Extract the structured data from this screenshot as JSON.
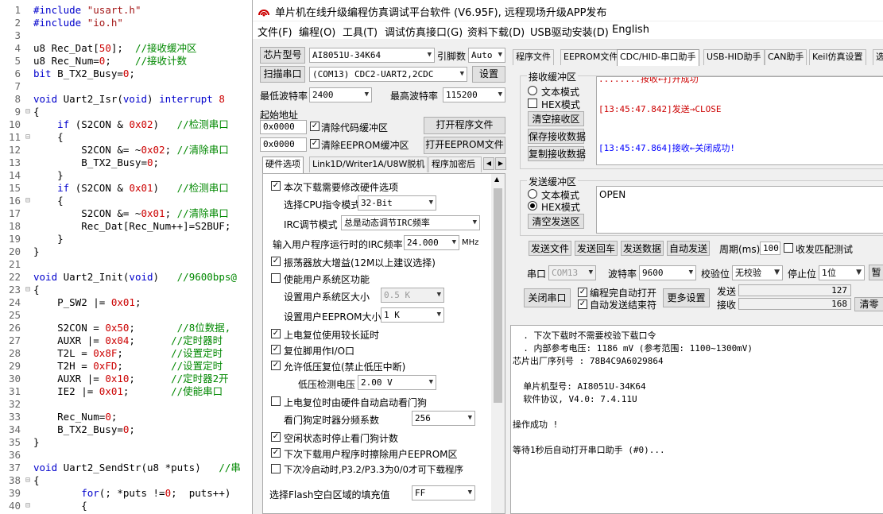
{
  "editor": {
    "lines": [
      {
        "n": "1",
        "fold": "",
        "html": "<span class='pp'>#include</span> <span class='str'>\"usart.h\"</span>"
      },
      {
        "n": "2",
        "fold": "",
        "html": "<span class='pp'>#include</span> <span class='str'>\"io.h\"</span>"
      },
      {
        "n": "3",
        "fold": "",
        "html": ""
      },
      {
        "n": "4",
        "fold": "",
        "html": "u8 Rec_Dat[<span class='num'>50</span>];  <span class='cm'>//接收缓冲区</span>"
      },
      {
        "n": "5",
        "fold": "",
        "html": "u8 Rec_Num=<span class='num'>0</span>;    <span class='cm'>//接收计数</span>"
      },
      {
        "n": "6",
        "fold": "",
        "html": "<span class='kw'>bit</span> B_TX2_Busy=<span class='num'>0</span>;"
      },
      {
        "n": "7",
        "fold": "",
        "html": ""
      },
      {
        "n": "8",
        "fold": "",
        "html": "<span class='kw'>void</span> Uart2_Isr(<span class='kw'>void</span>) <span class='kw'>interrupt</span> <span class='num'>8</span>"
      },
      {
        "n": "9",
        "fold": "⊟",
        "html": "{"
      },
      {
        "n": "10",
        "fold": "",
        "html": "    <span class='kw'>if</span> (S2CON &amp; <span class='num'>0x02</span>)   <span class='cm'>//检测串口</span>"
      },
      {
        "n": "11",
        "fold": "⊟",
        "html": "    {"
      },
      {
        "n": "12",
        "fold": "",
        "html": "        S2CON &amp;= ~<span class='num'>0x02</span>; <span class='cm'>//清除串口</span>"
      },
      {
        "n": "13",
        "fold": "",
        "html": "        B_TX2_Busy=<span class='num'>0</span>;"
      },
      {
        "n": "14",
        "fold": "",
        "html": "    }"
      },
      {
        "n": "15",
        "fold": "",
        "html": "    <span class='kw'>if</span> (S2CON &amp; <span class='num'>0x01</span>)   <span class='cm'>//检测串口</span>"
      },
      {
        "n": "16",
        "fold": "⊟",
        "html": "    {"
      },
      {
        "n": "17",
        "fold": "",
        "html": "        S2CON &amp;= ~<span class='num'>0x01</span>; <span class='cm'>//清除串口</span>"
      },
      {
        "n": "18",
        "fold": "",
        "html": "        Rec_Dat[Rec_Num++]=S2BUF;"
      },
      {
        "n": "19",
        "fold": "",
        "html": "    }"
      },
      {
        "n": "20",
        "fold": "",
        "html": "}"
      },
      {
        "n": "21",
        "fold": "",
        "html": ""
      },
      {
        "n": "22",
        "fold": "",
        "html": "<span class='kw'>void</span> Uart2_Init(<span class='kw'>void</span>)   <span class='cm'>//9600bps@</span>"
      },
      {
        "n": "23",
        "fold": "⊟",
        "html": "{"
      },
      {
        "n": "24",
        "fold": "",
        "html": "    P_SW2 |= <span class='num'>0x01</span>;"
      },
      {
        "n": "25",
        "fold": "",
        "html": ""
      },
      {
        "n": "26",
        "fold": "",
        "html": "    S2CON = <span class='num'>0x50</span>;       <span class='cm'>//8位数据,</span>"
      },
      {
        "n": "27",
        "fold": "",
        "html": "    AUXR |= <span class='num'>0x04</span>;      <span class='cm'>//定时器时</span>"
      },
      {
        "n": "28",
        "fold": "",
        "html": "    T2L = <span class='num'>0x8F</span>;        <span class='cm'>//设置定时</span>"
      },
      {
        "n": "29",
        "fold": "",
        "html": "    T2H = <span class='num'>0xFD</span>;        <span class='cm'>//设置定时</span>"
      },
      {
        "n": "30",
        "fold": "",
        "html": "    AUXR |= <span class='num'>0x10</span>;      <span class='cm'>//定时器2开</span>"
      },
      {
        "n": "31",
        "fold": "",
        "html": "    IE2 |= <span class='num'>0x01</span>;       <span class='cm'>//使能串口</span>"
      },
      {
        "n": "32",
        "fold": "",
        "html": ""
      },
      {
        "n": "33",
        "fold": "",
        "html": "    Rec_Num=<span class='num'>0</span>;"
      },
      {
        "n": "34",
        "fold": "",
        "html": "    B_TX2_Busy=<span class='num'>0</span>;"
      },
      {
        "n": "35",
        "fold": "",
        "html": "}"
      },
      {
        "n": "36",
        "fold": "",
        "html": ""
      },
      {
        "n": "37",
        "fold": "",
        "html": "<span class='kw'>void</span> Uart2_SendStr(u8 *puts)   <span class='cm'>//串</span>"
      },
      {
        "n": "38",
        "fold": "⊟",
        "html": "{"
      },
      {
        "n": "39",
        "fold": "",
        "html": "        <span class='kw'>for</span>(; *puts !=<span class='num'>0</span>;  puts++)"
      },
      {
        "n": "40",
        "fold": "⊟",
        "html": "        {"
      }
    ]
  },
  "window": {
    "title": "单片机在线升级编程仿真调试平台软件 (V6.95F), 远程现场升级APP发布",
    "menus": [
      "文件(F)",
      "编程(O)",
      "工具(T)",
      "调试仿真接口(G)",
      "资料下载(D)",
      "USB驱动安装(D)",
      "English"
    ]
  },
  "left": {
    "chip_btn": "芯片型号",
    "chip_value": "AI8051U-34K64",
    "pins_label": "引脚数",
    "pins_value": "Auto",
    "scan_btn": "扫描串口",
    "port_value": "(COM13) CDC2-UART2,2CDC",
    "settings_btn": "设置",
    "min_baud_label": "最低波特率",
    "min_baud": "2400",
    "max_baud_label": "最高波特率",
    "max_baud": "115200",
    "start_addr_label": "起始地址",
    "addr1": "0x0000",
    "clear_code": "清除代码缓冲区",
    "open_prog": "打开程序文件",
    "addr2": "0x0000",
    "clear_eeprom": "清除EEPROM缓冲区",
    "open_eeprom": "打开EEPROM文件",
    "tabs": [
      "硬件选项",
      "Link1D/Writer1A/U8W脱机",
      "程序加密后"
    ],
    "opts": {
      "o1": "本次下载需要修改硬件选项",
      "cpu_label": "选择CPU指令模式",
      "cpu_value": "32-Bit",
      "irc_label": "IRC调节模式",
      "irc_value": "总是动态调节IRC频率",
      "freq_label": "输入用户程序运行时的IRC频率",
      "freq_value": "24.000",
      "freq_unit": "MHz",
      "o2": "振荡器放大增益(12M以上建议选择)",
      "o3": "使能用户系统区功能",
      "sys_size_label": "设置用户系统区大小",
      "sys_size": "0.5 K",
      "eep_size_label": "设置用户EEPROM大小",
      "eep_size": "1   K",
      "o4": "上电复位使用较长延时",
      "o5": "复位脚用作I/O口",
      "o6": "允许低压复位(禁止低压中断)",
      "lv_label": "低压检测电压",
      "lv_value": "2.00 V",
      "o7": "上电复位时由硬件自动启动看门狗",
      "wd_label": "看门狗定时器分频系数",
      "wd_value": "256",
      "o8": "空闲状态时停止看门狗计数",
      "o9": "下次下载用户程序时擦除用户EEPROM区",
      "o10": "下次冷启动时,P3.2/P3.3为0/0才可下载程序",
      "fill_label": "选择Flash空白区域的填充值",
      "fill_value": "FF"
    }
  },
  "right": {
    "tabs": [
      "程序文件",
      "EEPROM文件",
      "CDC/HID-串口助手",
      "USB-HID助手",
      "CAN助手",
      "Keil仿真设置",
      "选"
    ],
    "recv_title": "接收缓冲区",
    "recv_text": "文本模式",
    "recv_hex": "HEX模式",
    "clear_recv": "清空接收区",
    "save_recv": "保存接收数据",
    "copy_recv": "复制接收数据",
    "recv_log": [
      "........按收←打开成功",
      "",
      "[13:45:47.842]发送→CLOSE",
      "",
      "",
      "[13:45:47.864]接收←关闭成功!"
    ],
    "send_title": "发送缓冲区",
    "send_text": "文本模式",
    "send_hex": "HEX模式",
    "clear_send": "清空发送区",
    "send_value": "OPEN",
    "send_file": "发送文件",
    "send_cr": "发送回车",
    "send_data": "发送数据",
    "auto_send": "自动发送",
    "period_label": "周期(ms)",
    "period": "100",
    "match_label": "收发匹配测试",
    "port_label": "串口",
    "port": "COM13",
    "baud_label": "波特率",
    "baud": "9600",
    "parity_label": "校验位",
    "parity": "无校验",
    "stop_label": "停止位",
    "stop": "1位",
    "pause": "暂",
    "close_port": "关闭串口",
    "auto_open": "编程完自动打开",
    "auto_send_end": "自动发送结束符",
    "more": "更多设置",
    "sent_label": "发送",
    "sent": "127",
    "recv_label": "接收",
    "recv": "168",
    "clear_count": "清零"
  },
  "status_log": [
    "  . 下次下载时不需要校验下载口令",
    "  . 内部参考电压: 1186 mV (参考范围: 1100~1300mV)",
    "芯片出厂序列号 : 78B4C9A6029864",
    "",
    "  单片机型号: AI8051U-34K64",
    "  软件协议, V4.0: 7.4.11U",
    "",
    "操作成功 !",
    "",
    "等待1秒后自动打开串口助手 (#0)..."
  ]
}
